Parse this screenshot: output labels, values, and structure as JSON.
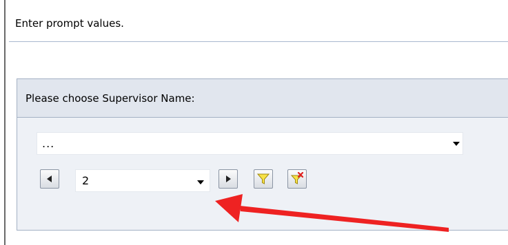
{
  "dialog": {
    "header_text": "Enter prompt values."
  },
  "prompt": {
    "title": "Please choose Supervisor Name:",
    "value_select": {
      "selected": "..."
    },
    "paging": {
      "page_selected": "2"
    }
  },
  "icons": {
    "prev": "triangle-left-icon",
    "next": "triangle-right-icon",
    "filter": "funnel-icon",
    "clear_filter": "funnel-x-icon",
    "dropdown": "chevron-down-icon"
  },
  "colors": {
    "panel_bg": "#eef1f6",
    "panel_header_bg": "#e1e6ee",
    "panel_border": "#a3b1c4",
    "divider": "#a9b8ce",
    "funnel_fill": "#f7e246",
    "clear_x": "#e02020",
    "annotation_arrow": "#ee2222"
  }
}
